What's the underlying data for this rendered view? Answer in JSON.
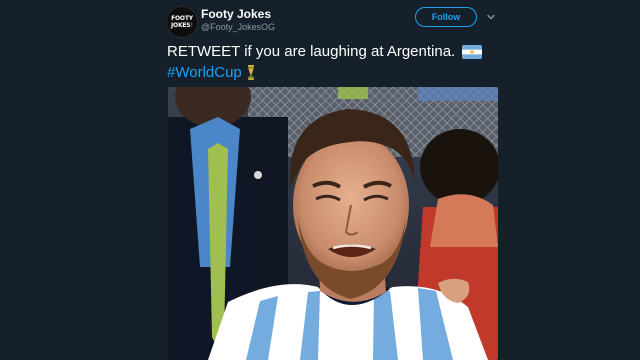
{
  "tweet": {
    "author": {
      "avatar_line1": "FOOTY",
      "avatar_line2_a": "JOKES",
      "avatar_line2_b": "!",
      "display_name": "Footy Jokes",
      "handle": "@Footy_JokesOG"
    },
    "follow_label": "Follow",
    "text_line1": "RETWEET if you are laughing at Argentina.",
    "hashtag": "#WorldCup"
  },
  "colors": {
    "background": "#15202b",
    "accent": "#1da1f2",
    "secondary_text": "#8899a6"
  },
  "icons": {
    "caret": "chevron-down-icon",
    "flag": "argentina-flag-emoji",
    "trophy": "world-cup-trophy-emoji"
  }
}
